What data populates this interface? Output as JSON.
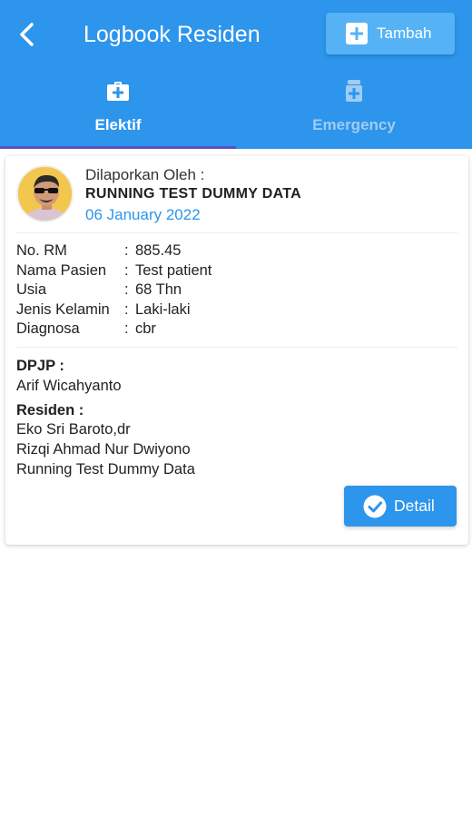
{
  "header": {
    "title": "Logbook Residen",
    "add_button_label": "Tambah",
    "background_color": "#2d95ec",
    "back_icon": "chevron-left-icon",
    "add_icon": "plus-square-icon"
  },
  "tabs": [
    {
      "label": "Elektif",
      "icon": "medical-bag-icon",
      "active": true
    },
    {
      "label": "Emergency",
      "icon": "medicine-bottle-icon",
      "active": false
    }
  ],
  "card": {
    "reported_by_label": "Dilaporkan Oleh :",
    "reporter": "RUNNING TEST DUMMY DATA",
    "date": "06 January 2022",
    "fields": [
      {
        "label": "No. RM",
        "value": "885.45"
      },
      {
        "label": "Nama Pasien",
        "value": "Test patient"
      },
      {
        "label": "Usia",
        "value": "68 Thn"
      },
      {
        "label": "Jenis Kelamin",
        "value": "Laki-laki"
      },
      {
        "label": "Diagnosa",
        "value": "cbr"
      }
    ],
    "separator": ":",
    "dpjp_label": "DPJP :",
    "dpjp": "Arif Wicahyanto",
    "residen_label": "Residen :",
    "residen": [
      "Eko Sri Baroto,dr",
      "Rizqi Ahmad Nur Dwiyono",
      "Running Test Dummy Data"
    ],
    "detail_button_label": "Detail",
    "detail_icon": "check-circle-icon"
  }
}
